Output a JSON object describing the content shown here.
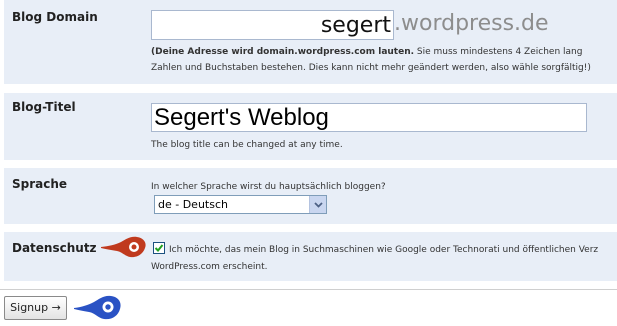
{
  "blog_domain": {
    "label": "Blog Domain",
    "value": "segert",
    "suffix": ".wordpress.de",
    "help_bold": "(Deine Adresse wird domain.wordpress.com lauten.",
    "help_rest": " Sie muss mindestens 4 Zeichen lang",
    "help_line2": "Zahlen und Buchstaben bestehen. Dies kann nicht mehr geändert werden, also wähle sorgfältig!)"
  },
  "blog_title": {
    "label": "Blog-Titel",
    "value": "Segert's Weblog",
    "help": "The blog title can be changed at any time."
  },
  "language": {
    "label": "Sprache",
    "question": "In welcher Sprache wirst du hauptsächlich bloggen?",
    "selected": "de - Deutsch"
  },
  "privacy": {
    "label": "Datenschutz",
    "checked": true,
    "text_line1": "Ich möchte, das mein Blog in Suchmaschinen wie Google oder Technorati und öffentlichen Verz",
    "text_line2": "WordPress.com erscheint."
  },
  "signup_button": {
    "label": "Signup →"
  },
  "colors": {
    "row_background": "#e8eef7",
    "red_marker": "#c03a1e",
    "blue_marker": "#2a52c4"
  },
  "icons": {
    "select_arrow": "chevron-down-icon",
    "checkbox_mark": "checkmark-icon",
    "red_marker": "pointer-marker-red-icon",
    "blue_marker": "pointer-marker-blue-icon"
  }
}
